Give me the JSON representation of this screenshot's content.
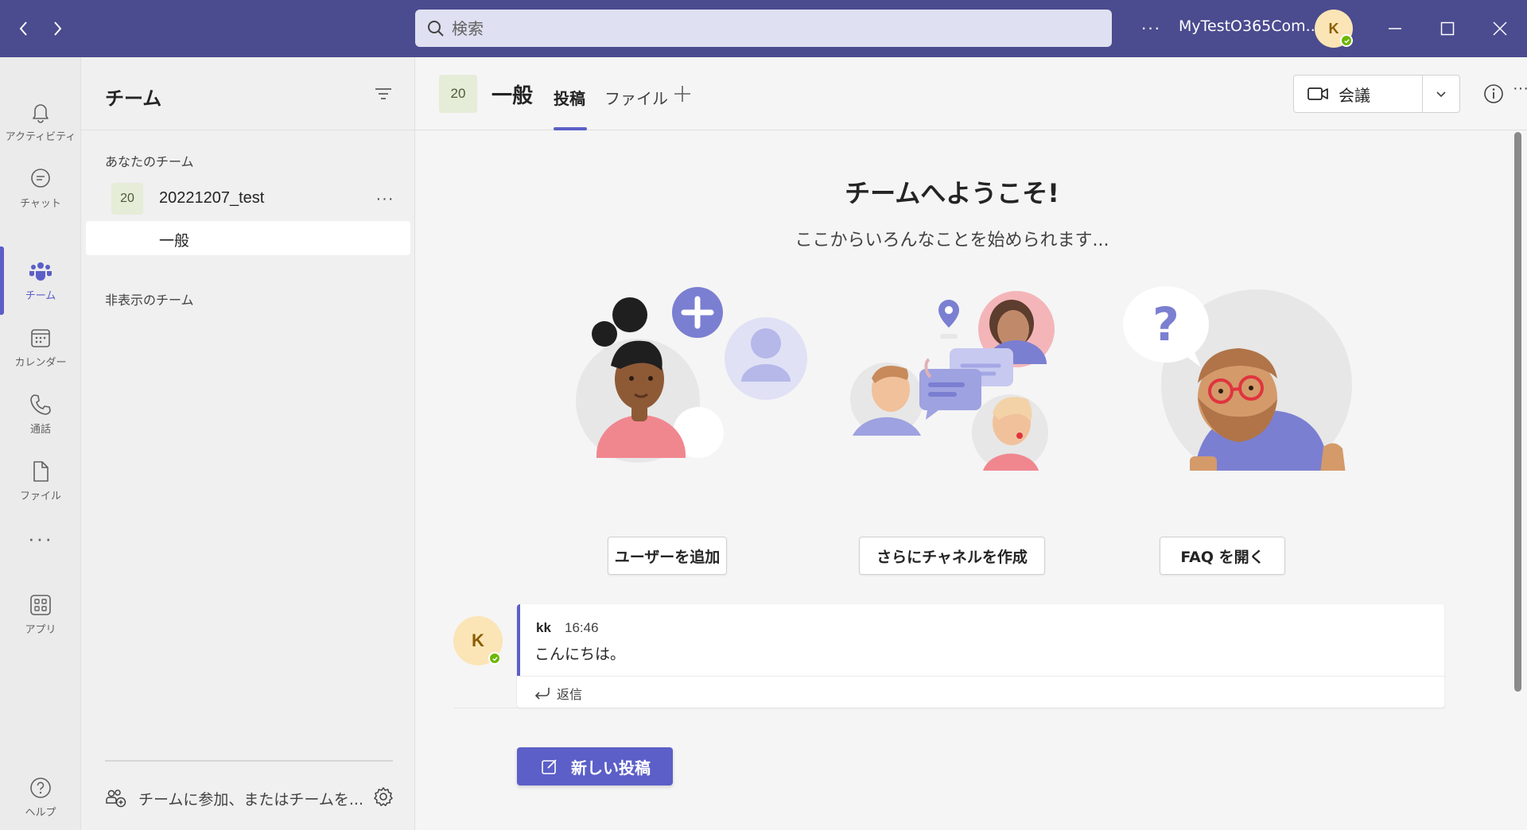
{
  "titlebar": {
    "search_placeholder": "検索",
    "more_label": "···",
    "org_name": "MyTestO365Com...",
    "avatar_initial": "K"
  },
  "rail": {
    "items": [
      {
        "label": "アクティビティ",
        "icon": "bell-icon"
      },
      {
        "label": "チャット",
        "icon": "chat-icon"
      },
      {
        "label": "チーム",
        "icon": "teams-icon"
      },
      {
        "label": "カレンダー",
        "icon": "calendar-icon"
      },
      {
        "label": "通話",
        "icon": "phone-icon"
      },
      {
        "label": "ファイル",
        "icon": "file-icon"
      },
      {
        "label": "アプリ",
        "icon": "apps-icon"
      },
      {
        "label": "ヘルプ",
        "icon": "help-icon"
      }
    ],
    "more_label": "···",
    "active_item": "チーム"
  },
  "teams_panel": {
    "title": "チーム",
    "your_teams_label": "あなたのチーム",
    "team": {
      "badge": "20",
      "name": "20221207_test",
      "more_label": "···"
    },
    "channel": {
      "name": "一般"
    },
    "hidden_teams_label": "非表示のチーム",
    "join_label": "チームに参加、またはチームを..."
  },
  "channel_header": {
    "badge": "20",
    "title": "一般",
    "tabs": [
      {
        "label": "投稿",
        "active": true
      },
      {
        "label": "ファイル",
        "active": false
      }
    ],
    "meeting_label": "会議",
    "more_label": "···"
  },
  "welcome": {
    "title": "チームへようこそ!",
    "subtitle": "ここからいろんなことを始められます..."
  },
  "actions": [
    {
      "label": "ユーザーを追加"
    },
    {
      "label": "さらにチャネルを作成"
    },
    {
      "label": "FAQ を開く"
    }
  ],
  "message": {
    "avatar_initial": "K",
    "author": "kk",
    "time": "16:46",
    "body": "こんにちは。",
    "reply_label": "返信"
  },
  "new_post_label": "新しい投稿",
  "colors": {
    "titlebar": "#4b4b8f",
    "accent": "#5b5fc7",
    "presence": "#6bb700",
    "avatar_bg": "#fbe5b6",
    "team_badge_bg": "#e5ecd8"
  }
}
